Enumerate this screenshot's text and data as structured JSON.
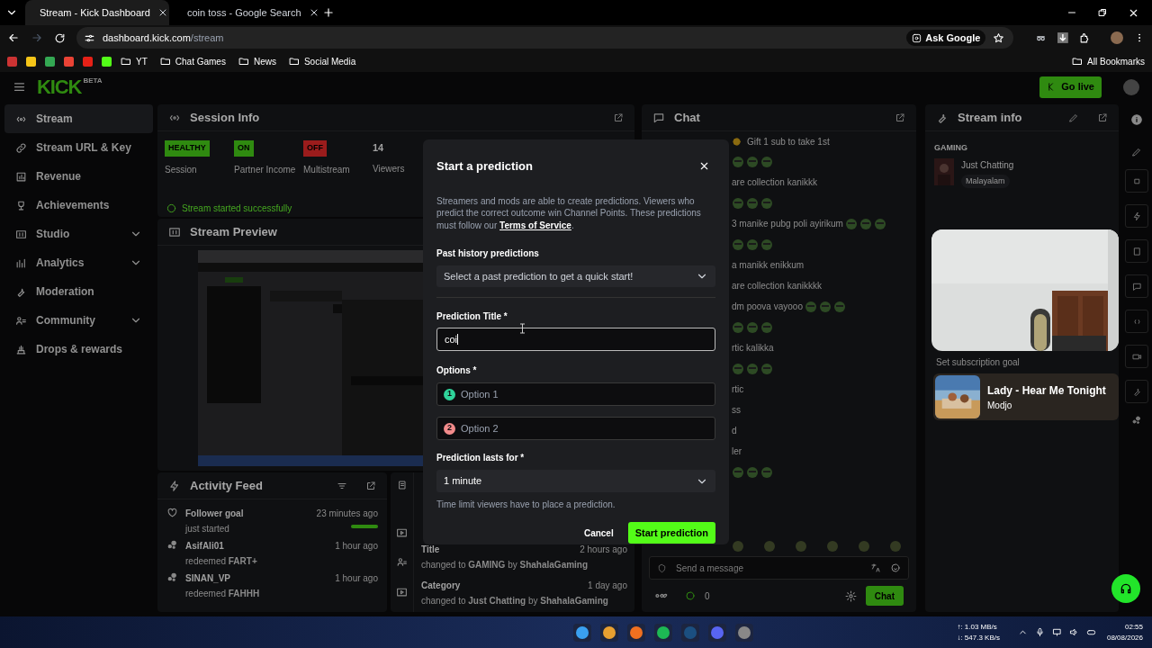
{
  "browser": {
    "tabs": [
      {
        "title": "Stream - Kick Dashboard",
        "selected": true
      },
      {
        "title": "coin toss - Google Search",
        "selected": false
      }
    ],
    "url_domain": "dashboard.kick.com",
    "url_path": "/stream",
    "ask_google": "Ask Google",
    "bookmarks": [
      "YT",
      "Chat Games",
      "News",
      "Social Media"
    ],
    "all_bookmarks": "All Bookmarks"
  },
  "header": {
    "logo": "KICK",
    "logo_badge": "BETA",
    "go_live": "Go live"
  },
  "sidebar": {
    "items": [
      {
        "label": "Stream",
        "selected": true,
        "expandable": false
      },
      {
        "label": "Stream URL & Key",
        "selected": false,
        "expandable": false
      },
      {
        "label": "Revenue",
        "selected": false,
        "expandable": false
      },
      {
        "label": "Achievements",
        "selected": false,
        "expandable": false
      },
      {
        "label": "Studio",
        "selected": false,
        "expandable": true
      },
      {
        "label": "Analytics",
        "selected": false,
        "expandable": true
      },
      {
        "label": "Moderation",
        "selected": false,
        "expandable": false
      },
      {
        "label": "Community",
        "selected": false,
        "expandable": true
      },
      {
        "label": "Drops & rewards",
        "selected": false,
        "expandable": false
      }
    ]
  },
  "session_info": {
    "title": "Session Info",
    "stats": [
      {
        "kind": "badge",
        "value": "HEALTHY",
        "label": "Session",
        "color": "#2f8a10"
      },
      {
        "kind": "badge",
        "value": "ON",
        "label": "Partner Income",
        "color": "#2f8a10"
      },
      {
        "kind": "badge",
        "value": "OFF",
        "label": "Multistream",
        "color": "#9b1c1c"
      },
      {
        "kind": "number",
        "value": "14",
        "label": "Viewers"
      }
    ],
    "notice": "Stream started successfully"
  },
  "stream_preview": {
    "title": "Stream Preview"
  },
  "activity_feed": {
    "title": "Activity Feed",
    "items": [
      {
        "kind": "goal",
        "name": "Follower goal",
        "detail": "just started",
        "time": "23 minutes ago",
        "level": 1
      },
      {
        "kind": "redeem",
        "name": "AsifAli01",
        "detail": "redeemed **FART+**",
        "time": "1 hour ago"
      },
      {
        "kind": "redeem",
        "name": "SINAN_VP",
        "detail": "redeemed **FAHHH**",
        "time": "1 hour ago"
      }
    ]
  },
  "stream_events": {
    "items": [
      {
        "title": "Title",
        "time": "2 hours ago",
        "detail": "changed to **GAMING** by **ShahalaGaming**"
      },
      {
        "title": "Category",
        "time": "1 day ago",
        "detail": "changed to **Just Chatting** by **ShahalaGaming**"
      }
    ]
  },
  "chat": {
    "title": "Chat",
    "pinned": "Gift 1 sub to take 1st",
    "messages": [
      {
        "kind": "emotes"
      },
      {
        "kind": "text",
        "text": "are collection kanikkk"
      },
      {
        "kind": "emotes"
      },
      {
        "kind": "text_emotes",
        "text": "3 manike pubg poli ayirikum"
      },
      {
        "kind": "emotes"
      },
      {
        "kind": "text",
        "text": "a manikk enikkum"
      },
      {
        "kind": "text",
        "text": "are collection kanikkkk"
      },
      {
        "kind": "text_emotes",
        "text": "dm poova vayooo"
      },
      {
        "kind": "emotes"
      },
      {
        "kind": "text",
        "text": "rtic kalikka"
      },
      {
        "kind": "emotes"
      },
      {
        "kind": "text",
        "text": "rtic"
      },
      {
        "kind": "text",
        "text": "ss"
      },
      {
        "kind": "text",
        "text": "d"
      },
      {
        "kind": "text",
        "text": "ler"
      },
      {
        "kind": "emotes"
      }
    ],
    "input_placeholder": "Send a message",
    "points": "0",
    "send": "Chat"
  },
  "stream_info": {
    "title": "Stream info",
    "group": "GAMING",
    "category": "Just Chatting",
    "tag": "Malayalam",
    "goal": "Set subscription goal"
  },
  "now_playing": {
    "title": "Lady - Hear Me Tonight",
    "artist": "Modjo"
  },
  "modal": {
    "title": "Start a prediction",
    "description": "Streamers and mods are able to create predictions. Viewers who predict the correct outcome win Channel Points. These predictions must follow our",
    "link": "Terms of Service",
    "description_end": ".",
    "past_label": "Past history predictions",
    "past_placeholder": "Select a past prediction to get a quick start!",
    "title_label": "Prediction Title *",
    "title_value": "coi",
    "options_label": "Options *",
    "options": [
      {
        "number": "1",
        "placeholder": "Option 1",
        "color": "#2fd39a"
      },
      {
        "number": "2",
        "placeholder": "Option 2",
        "color": "#f28b8b"
      }
    ],
    "duration_label": "Prediction lasts for *",
    "duration": "1 minute",
    "hint": "Time limit viewers have to place a prediction.",
    "cancel": "Cancel",
    "submit": "Start prediction"
  },
  "taskbar": {
    "upload": "↑: 1.03 MB/s",
    "download": "↓: 547.3 KB/s",
    "time": "02:55",
    "date": "08/08/2026"
  }
}
